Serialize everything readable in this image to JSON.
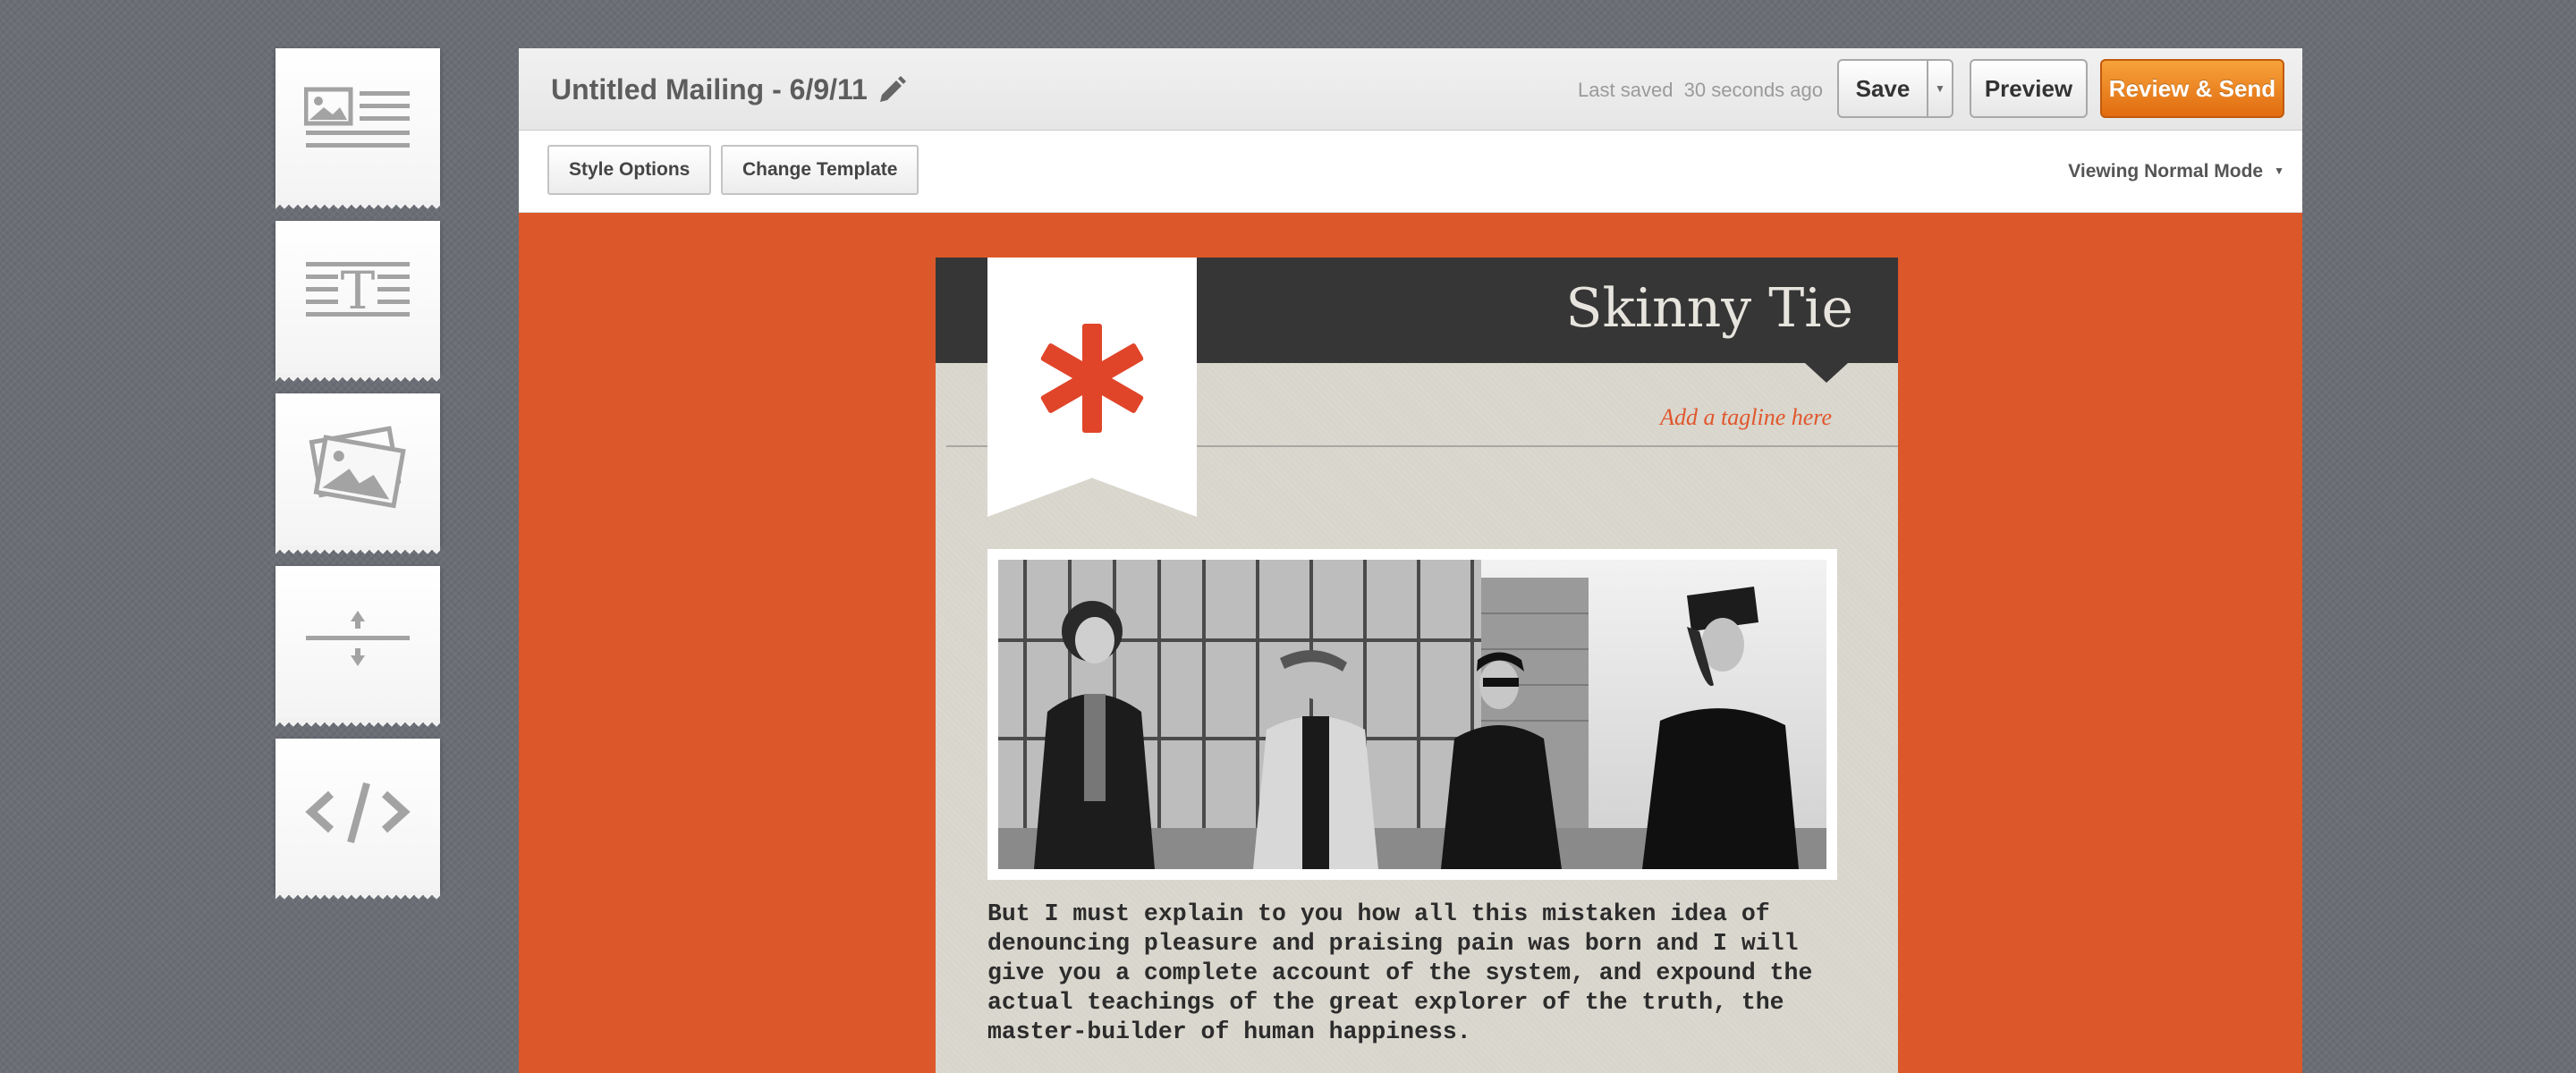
{
  "palette": {
    "blocks": [
      {
        "icon": "image-text-block-icon"
      },
      {
        "icon": "text-block-icon"
      },
      {
        "icon": "image-block-icon"
      },
      {
        "icon": "spacer-block-icon"
      },
      {
        "icon": "code-block-icon"
      }
    ]
  },
  "header": {
    "title": "Untitled Mailing - 6/9/11",
    "edit_icon": "pencil-icon",
    "last_saved": "Last saved  30 seconds ago",
    "save_label": "Save",
    "preview_label": "Preview",
    "review_label": "Review & Send"
  },
  "toolbar": {
    "style_options_label": "Style Options",
    "change_template_label": "Change Template",
    "view_mode_label": "Viewing Normal Mode"
  },
  "email": {
    "brand_name": "Skinny Tie",
    "tagline": "Add a tagline here",
    "logo_icon": "asterisk-icon",
    "body_text": "But I must explain to you how all this mistaken idea of denouncing pleasure and praising pain was born and I will give you a complete account of the system, and expound the actual teachings of the great explorer of the truth, the master-builder of human happiness."
  },
  "colors": {
    "canvas_background": "#dc582a",
    "accent": "#e0572c",
    "review_button": "#ee8a24",
    "header_dark": "#363636",
    "email_background": "#d8d5cc"
  }
}
